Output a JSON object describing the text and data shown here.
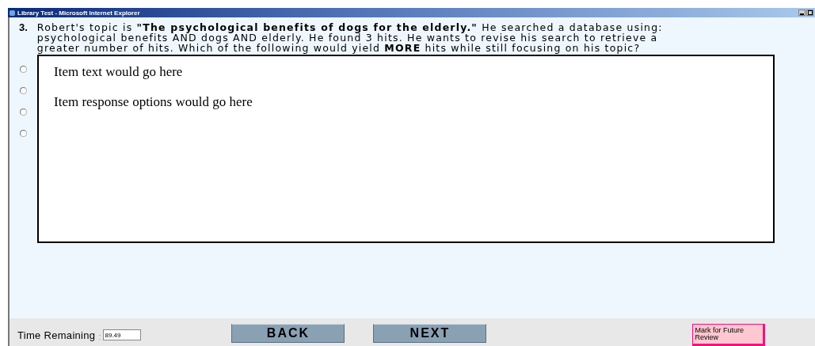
{
  "window": {
    "title": "Library Test - Microsoft Internet Explorer"
  },
  "question": {
    "number": "3.",
    "lines": [
      "Robert's topic is **\"The psychological benefits of dogs for the elderly.\"** He searched a database using:",
      "psychological benefits AND dogs AND elderly. He found 3 hits. He wants to revise his search to retrieve a",
      "greater number of hits. Which of the following would yield **MORE** hits while still focusing on his topic?"
    ]
  },
  "options": [
    {
      "selected": false
    },
    {
      "selected": false
    },
    {
      "selected": false
    },
    {
      "selected": false
    }
  ],
  "placeholder_box": {
    "lines": [
      "Item text would go here",
      "Item response options would go here"
    ]
  },
  "footer": {
    "time_label": "Time Remaining",
    "time_sep": ":",
    "time_value": "89.49",
    "back": "BACK",
    "next": "NEXT",
    "mark": "Mark for Future Review"
  }
}
